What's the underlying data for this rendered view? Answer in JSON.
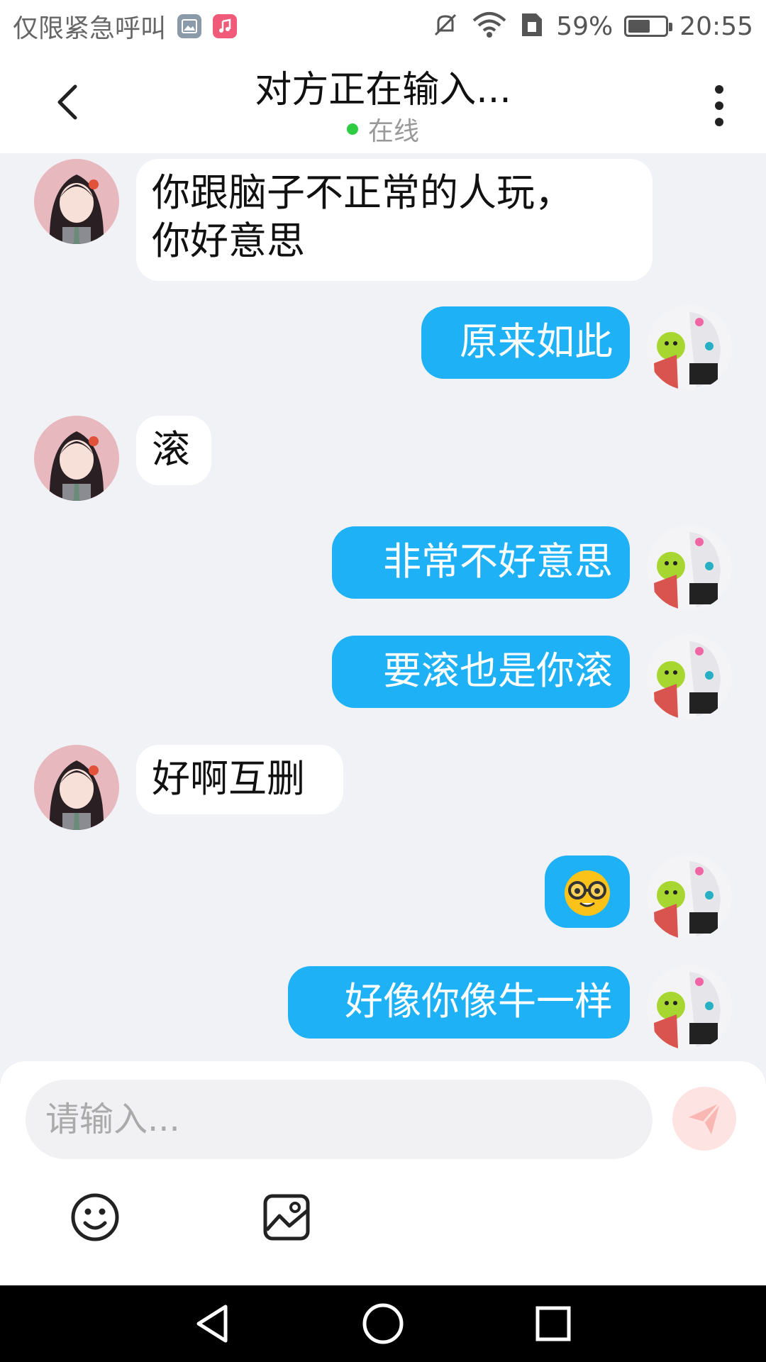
{
  "status_bar": {
    "carrier": "仅限紧急呼叫",
    "battery_percent": "59%",
    "battery_level": 0.59,
    "time": "20:55"
  },
  "header": {
    "title": "对方正在输入...",
    "status": "在线"
  },
  "messages": [
    {
      "direction": "in",
      "text_line1": "你跟脑子不正常的人玩，",
      "text_line2": "你好意思"
    },
    {
      "direction": "out",
      "text": "原来如此"
    },
    {
      "direction": "in",
      "text": "滚"
    },
    {
      "direction": "out",
      "text": "非常不好意思"
    },
    {
      "direction": "out",
      "text": "要滚也是你滚"
    },
    {
      "direction": "in",
      "text": "好啊互删"
    },
    {
      "direction": "out",
      "emoji": "nerd-face"
    },
    {
      "direction": "out",
      "text": "好像你像牛一样"
    }
  ],
  "composer": {
    "placeholder": "请输入..."
  },
  "colors": {
    "outgoing_bubble": "#1fb1f5",
    "incoming_bubble": "#ffffff",
    "chat_background": "#f1f2f6",
    "online_dot": "#2ecc40",
    "send_button": "#fde3e2"
  }
}
